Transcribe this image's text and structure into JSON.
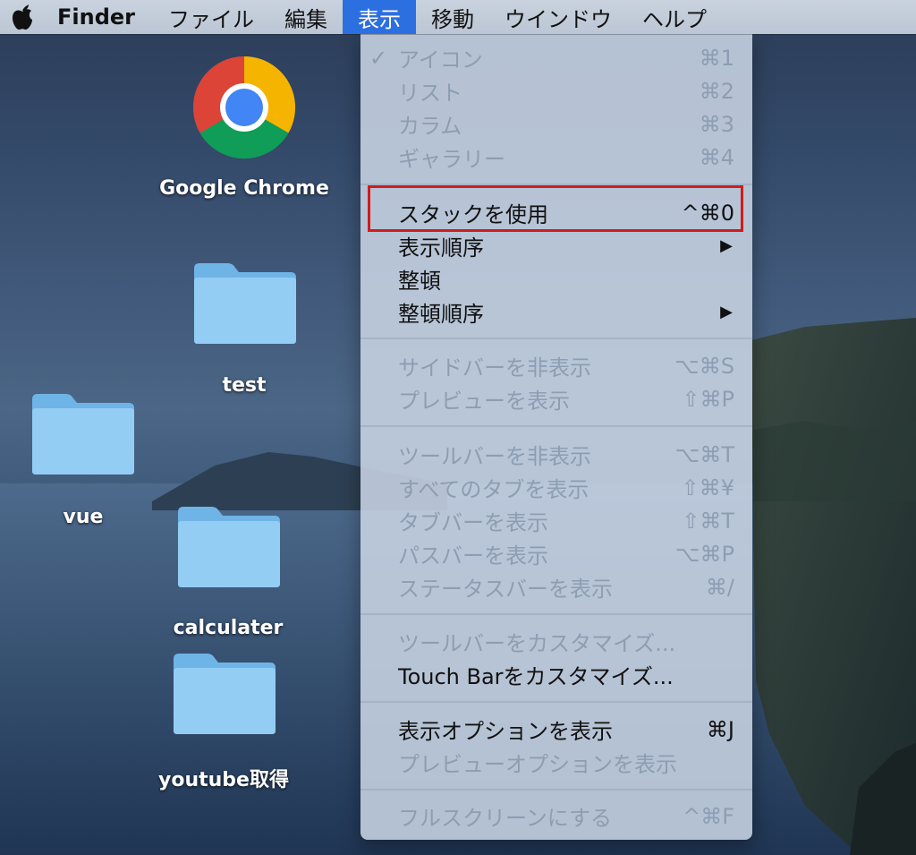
{
  "menubar": {
    "app_name": "Finder",
    "items": [
      {
        "label": "ファイル"
      },
      {
        "label": "編集"
      },
      {
        "label": "表示"
      },
      {
        "label": "移動"
      },
      {
        "label": "ウインドウ"
      },
      {
        "label": "ヘルプ"
      }
    ],
    "active_item": "表示"
  },
  "desktop_icons": [
    {
      "label": "Google Chrome",
      "icon": "chrome-icon"
    },
    {
      "label": "test",
      "icon": "folder-icon"
    },
    {
      "label": "vue",
      "icon": "folder-icon"
    },
    {
      "label": "calculater",
      "icon": "folder-icon"
    },
    {
      "label": "youtube取得",
      "icon": "folder-icon"
    }
  ],
  "view_menu": {
    "items": [
      {
        "label": "アイコン",
        "shortcut": "⌘1",
        "checked": "✓",
        "enabled": false
      },
      {
        "label": "リスト",
        "shortcut": "⌘2",
        "enabled": false
      },
      {
        "label": "カラム",
        "shortcut": "⌘3",
        "enabled": false
      },
      {
        "label": "ギャラリー",
        "shortcut": "⌘4",
        "enabled": false
      },
      {
        "label": "スタックを使用",
        "shortcut": "^⌘0",
        "enabled": true,
        "highlighted": true
      },
      {
        "label": "表示順序",
        "submenu": "▶",
        "enabled": true
      },
      {
        "label": "整頓",
        "enabled": true
      },
      {
        "label": "整頓順序",
        "submenu": "▶",
        "enabled": true
      },
      {
        "label": "サイドバーを非表示",
        "shortcut": "⌥⌘S",
        "enabled": false
      },
      {
        "label": "プレビューを表示",
        "shortcut": "⇧⌘P",
        "enabled": false
      },
      {
        "label": "ツールバーを非表示",
        "shortcut": "⌥⌘T",
        "enabled": false
      },
      {
        "label": "すべてのタブを表示",
        "shortcut": "⇧⌘¥",
        "enabled": false
      },
      {
        "label": "タブバーを表示",
        "shortcut": "⇧⌘T",
        "enabled": false
      },
      {
        "label": "パスバーを表示",
        "shortcut": "⌥⌘P",
        "enabled": false
      },
      {
        "label": "ステータスバーを表示",
        "shortcut": "⌘/",
        "enabled": false
      },
      {
        "label": "ツールバーをカスタマイズ...",
        "enabled": false
      },
      {
        "label": "Touch Barをカスタマイズ...",
        "enabled": true
      },
      {
        "label": "表示オプションを表示",
        "shortcut": "⌘J",
        "enabled": true
      },
      {
        "label": "プレビューオプションを表示",
        "enabled": false
      },
      {
        "label": "フルスクリーンにする",
        "shortcut": "^⌘F",
        "enabled": false
      }
    ]
  },
  "colors": {
    "menu_active": "#2c6fe0",
    "highlight_border": "#d11b1b",
    "folder_blue": "#8fcaf2"
  }
}
